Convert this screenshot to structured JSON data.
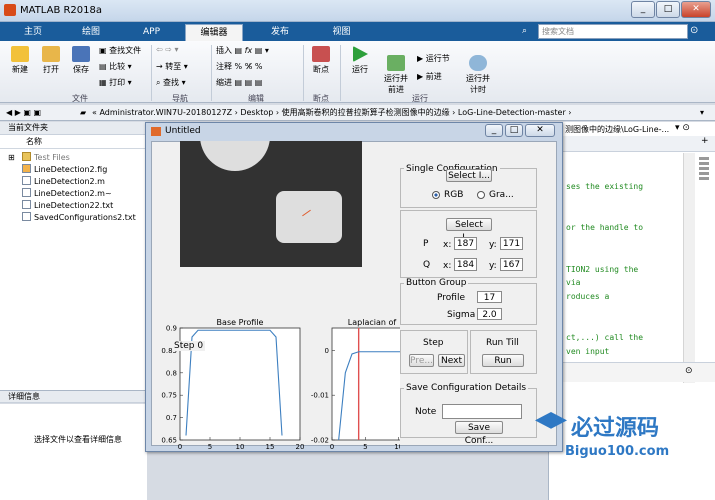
{
  "window": {
    "title": "MATLAB R2018a"
  },
  "search": {
    "placeholder": "搜索文档"
  },
  "tabs": [
    "主页",
    "绘图",
    "APP",
    "编辑器",
    "发布",
    "视图"
  ],
  "toolbar": {
    "new": "新建",
    "open": "打开",
    "save": "保存",
    "find_files": "查找文件",
    "compare": "比较",
    "print": "打印",
    "insert": "插入",
    "comment": "注释",
    "indent": "缩进",
    "goto": "转至",
    "find": "查找",
    "breakpoints": "断点",
    "run": "运行",
    "run_advance": "运行并\n前进",
    "run_section": "运行节",
    "advance": "前进",
    "run_time": "运行并\n计时",
    "groups": {
      "file": "文件",
      "nav": "导航",
      "edit": "编辑",
      "breakpoints": "断点",
      "run": "运行"
    }
  },
  "address": {
    "path": "« Administrator.WIN7U-20180127Z  ›  Desktop  ›  使用高斯卷积的拉普拉斯算子检测图像中的边缘  ›  LoG-Line-Detection-master  ›"
  },
  "current_folder": {
    "title": "当前文件夹",
    "col": "名称",
    "files": [
      "Test Files",
      "LineDetection2.fig",
      "LineDetection2.m",
      "LineDetection2.m~",
      "LineDetection22.txt",
      "SavedConfigurations2.txt"
    ]
  },
  "details": {
    "title": "详细信息",
    "hint": "选择文件以查看详细信息"
  },
  "editor": {
    "breadcrumb": "测图像中的边缘\\LoG-Line-...",
    "lines": [
      "ses the existing",
      "or the handle to",
      "TION2 using the",
      " via",
      "roduces a",
      "ct,...) call the",
      "ven input"
    ]
  },
  "figure": {
    "title": "Untitled",
    "single_config": "Single Configuration",
    "select_image": "Select I...",
    "rgb": "RGB",
    "gray": "Gra...",
    "select_line": "Select L...",
    "p_label": "P",
    "q_label": "Q",
    "x_label": "x:",
    "y_label": "y:",
    "p_x": "187",
    "p_y": "171",
    "q_x": "184",
    "q_y": "167",
    "button_group": "Button Group",
    "profile_label": "Profile",
    "profile_value": "17",
    "sigma_label": "Sigma",
    "sigma_value": "2.0",
    "step_label": "Step",
    "prev": "Pre...",
    "next": "Next",
    "run_till": "Run Till",
    "run": "Run",
    "save_details": "Save Configuration Details",
    "note_label": "Note",
    "save_conf": "Save Conf...",
    "step_text": "Step 0"
  },
  "chart_data": [
    {
      "type": "line",
      "title": "Base Profile",
      "x": [
        1,
        2,
        3,
        4,
        5,
        6,
        7,
        8,
        9,
        10,
        11,
        12,
        13,
        14,
        15,
        16,
        17
      ],
      "series": [
        {
          "values": [
            0.66,
            0.88,
            0.895,
            0.895,
            0.895,
            0.895,
            0.895,
            0.895,
            0.895,
            0.895,
            0.895,
            0.895,
            0.895,
            0.895,
            0.895,
            0.88,
            0.66
          ]
        }
      ],
      "xlim": [
        0,
        20
      ],
      "ylim": [
        0.65,
        0.9
      ],
      "xticks": [
        0,
        5,
        10,
        15,
        20
      ],
      "yticks": [
        0.65,
        0.7,
        0.75,
        0.8,
        0.85,
        0.9
      ],
      "color": "#3d7fc0"
    },
    {
      "type": "line",
      "title": "Laplacian of",
      "x": [
        1,
        2,
        3,
        4,
        5,
        6,
        7,
        8,
        9,
        10,
        11,
        12
      ],
      "series": [
        {
          "values": [
            -0.02,
            -0.005,
            -0.0008,
            -0.0003,
            -0.0003,
            -0.0003,
            -0.0003,
            -0.0003,
            -0.0003,
            -0.0003,
            -0.0003,
            -0.0003
          ]
        }
      ],
      "vline": 4,
      "xlim": [
        0,
        12
      ],
      "ylim": [
        -0.02,
        0.005
      ],
      "xticks": [
        0,
        5,
        10
      ],
      "yticks": [
        -0.02,
        -0.01,
        0
      ],
      "color": "#3d7fc0",
      "vline_color": "#e05050"
    }
  ],
  "watermark": {
    "text": "必过源码",
    "url": "Biguo100.com"
  }
}
